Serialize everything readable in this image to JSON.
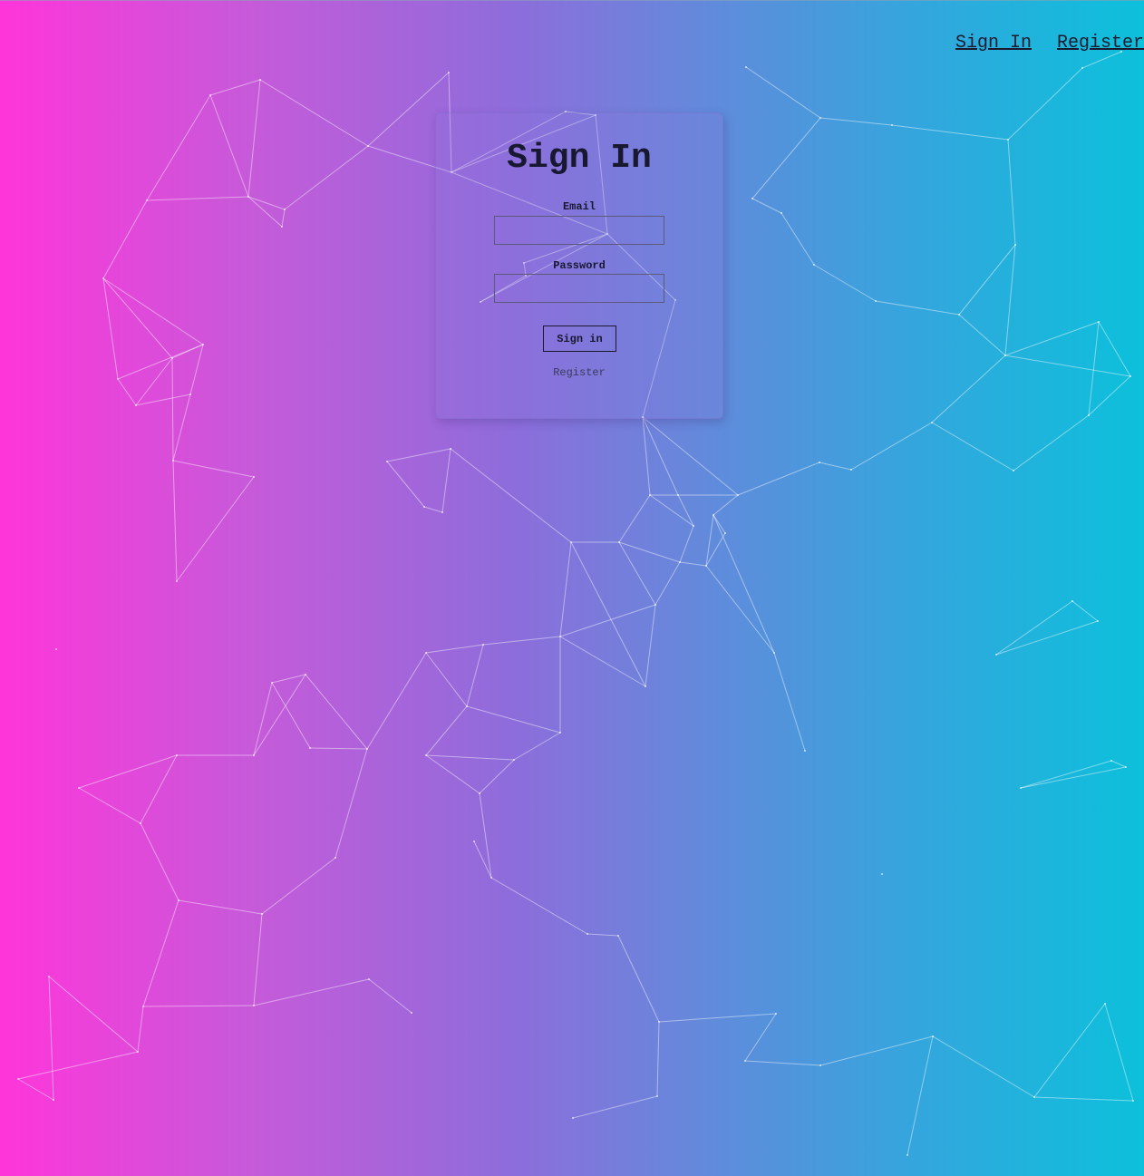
{
  "nav": {
    "sign_in": "Sign In",
    "register": "Register"
  },
  "form": {
    "title": "Sign In",
    "email_label": "Email",
    "email_value": "",
    "email_placeholder": "",
    "password_label": "Password",
    "password_value": "",
    "password_placeholder": "",
    "submit_label": "Sign in",
    "register_link": "Register"
  },
  "colors": {
    "gradient_start": "#ff35da",
    "gradient_end": "#0cc0db",
    "text_dark": "#181830",
    "network_lines": "#ffffff"
  }
}
